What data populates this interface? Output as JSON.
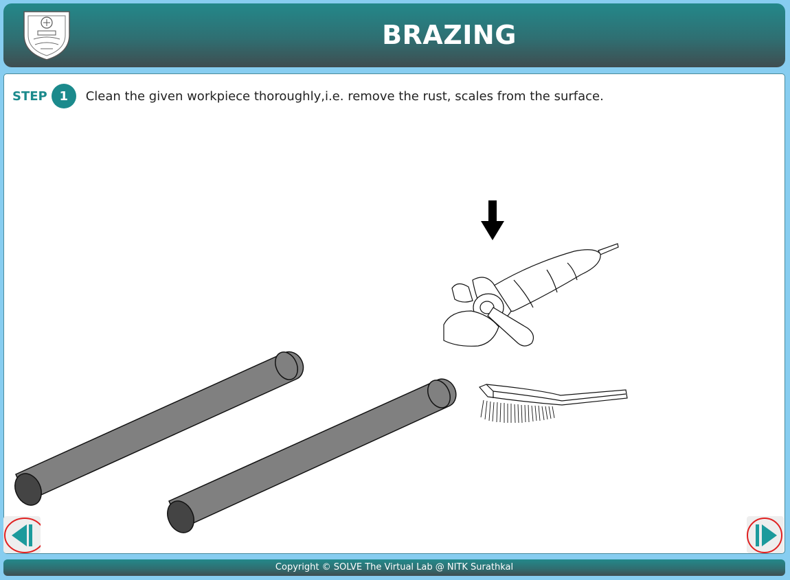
{
  "header": {
    "title": "BRAZING",
    "logo_icon": "nitk-crest-icon"
  },
  "step": {
    "label": "STEP",
    "number": "1",
    "instruction": "Clean the given workpiece thoroughly,i.e. remove the rust, scales from the surface."
  },
  "scene": {
    "items": [
      "workpiece-rod-icon",
      "workpiece-rod-icon",
      "down-arrow-icon",
      "angle-grinder-icon",
      "wire-brush-icon"
    ]
  },
  "navigation": {
    "prev_icon": "previous-icon",
    "next_icon": "next-icon"
  },
  "footer": {
    "copyright": "Copyright © SOLVE The Virtual Lab @ NITK Surathkal"
  },
  "colors": {
    "accent": "#1b8a8c",
    "background": "#87cdf0",
    "highlight": "#e02020",
    "rod": "#808080"
  }
}
